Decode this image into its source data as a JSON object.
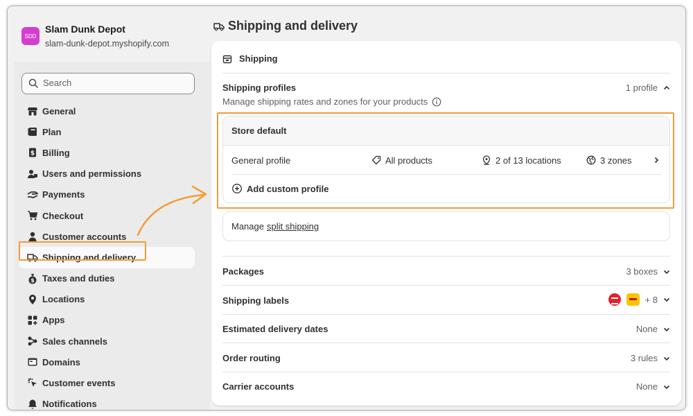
{
  "store": {
    "initials": "SDD",
    "name": "Slam Dunk Depot",
    "url": "slam-dunk-depot.myshopify.com"
  },
  "search": {
    "placeholder": "Search"
  },
  "nav": [
    {
      "label": "General",
      "icon": "store-icon"
    },
    {
      "label": "Plan",
      "icon": "plan-icon"
    },
    {
      "label": "Billing",
      "icon": "billing-icon"
    },
    {
      "label": "Users and permissions",
      "icon": "users-icon"
    },
    {
      "label": "Payments",
      "icon": "payments-icon"
    },
    {
      "label": "Checkout",
      "icon": "cart-icon"
    },
    {
      "label": "Customer accounts",
      "icon": "person-icon"
    },
    {
      "label": "Shipping and delivery",
      "icon": "truck-icon",
      "active": true
    },
    {
      "label": "Taxes and duties",
      "icon": "tax-icon"
    },
    {
      "label": "Locations",
      "icon": "location-icon"
    },
    {
      "label": "Apps",
      "icon": "apps-icon"
    },
    {
      "label": "Sales channels",
      "icon": "channels-icon"
    },
    {
      "label": "Domains",
      "icon": "domains-icon"
    },
    {
      "label": "Customer events",
      "icon": "cursor-icon"
    },
    {
      "label": "Notifications",
      "icon": "bell-icon"
    }
  ],
  "page": {
    "title": "Shipping and delivery"
  },
  "card": {
    "title": "Shipping",
    "profiles": {
      "title": "Shipping profiles",
      "count": "1 profile",
      "description": "Manage shipping rates and zones for your products",
      "store_default": "Store default",
      "general": {
        "name": "General profile",
        "products": "All products",
        "locations": "2 of 13 locations",
        "zones": "3 zones"
      },
      "add_custom": "Add custom profile"
    },
    "split": {
      "prefix": "Manage",
      "link": "split shipping"
    },
    "rows": [
      {
        "title": "Packages",
        "value": "3 boxes"
      },
      {
        "title": "Shipping labels",
        "value": "+ 8"
      },
      {
        "title": "Estimated delivery dates",
        "value": "None"
      },
      {
        "title": "Order routing",
        "value": "3 rules"
      },
      {
        "title": "Carrier accounts",
        "value": "None"
      }
    ]
  },
  "colors": {
    "accent_highlight": "#f39c34",
    "avatar": "#d43ecf"
  }
}
